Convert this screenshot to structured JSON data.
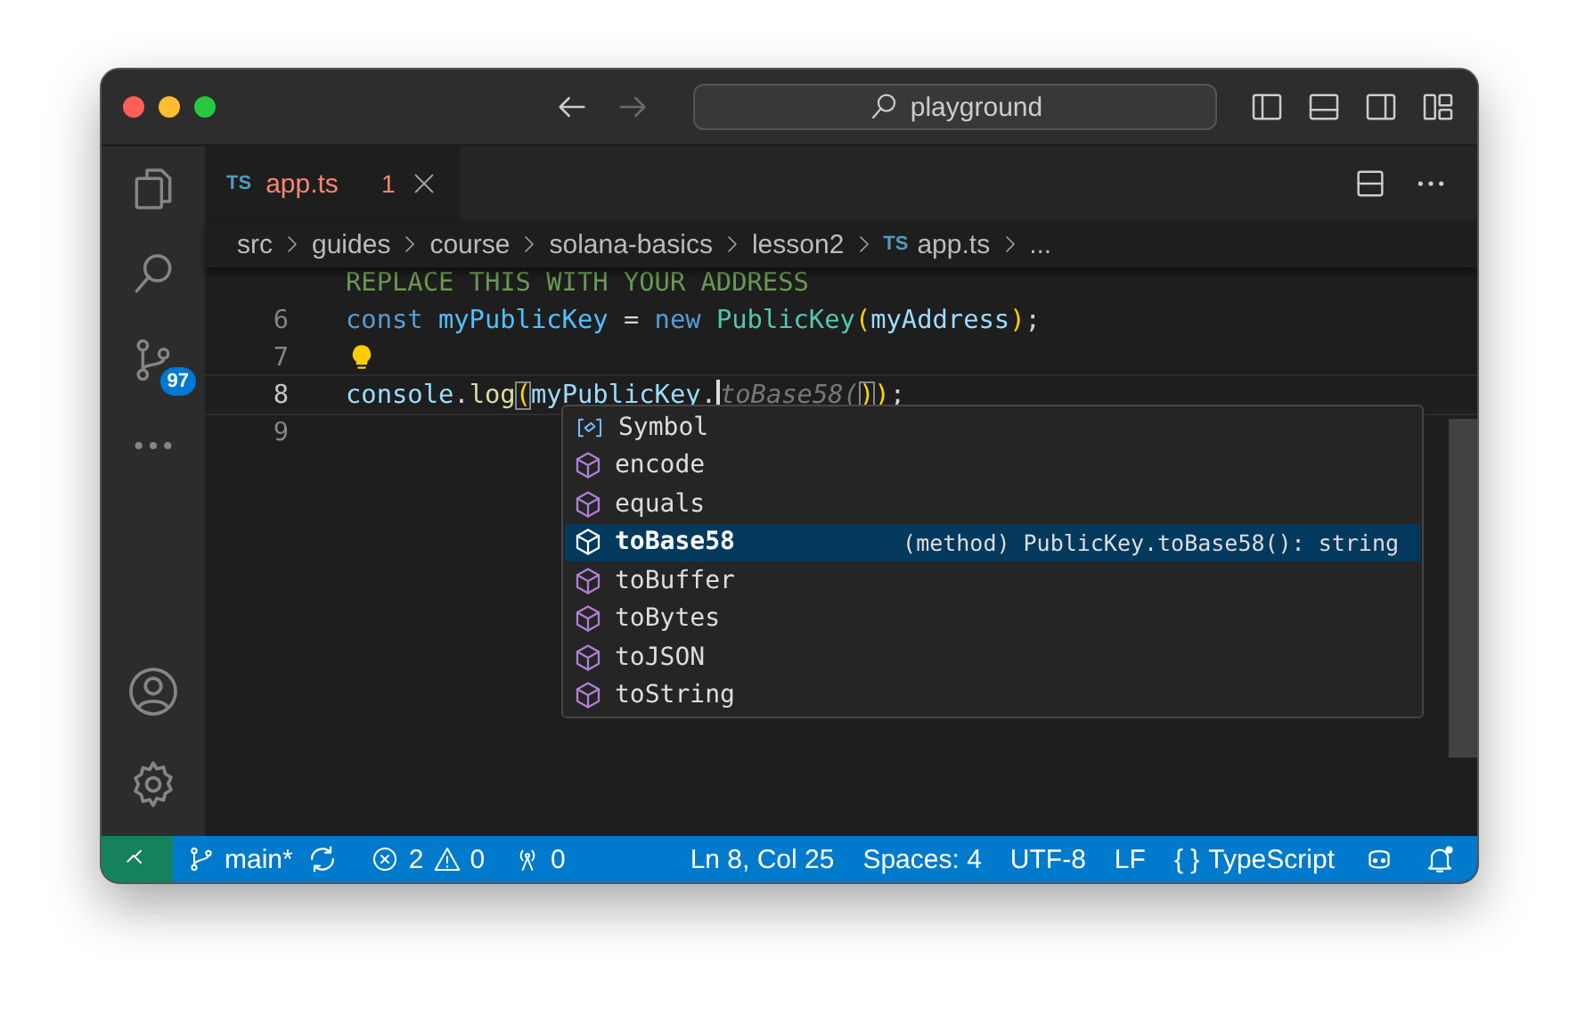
{
  "window": {
    "search": "playground",
    "nav": [
      {
        "kind": "back",
        "disabled": false
      },
      {
        "kind": "forward",
        "disabled": true
      }
    ]
  },
  "activity_bar": {
    "items": [
      {
        "kind": "explorer",
        "selected": false
      },
      {
        "kind": "search",
        "selected": false
      },
      {
        "kind": "source-control",
        "selected": false,
        "badge": "97"
      },
      {
        "kind": "more",
        "selected": false
      }
    ],
    "bottom": [
      {
        "kind": "account"
      },
      {
        "kind": "settings"
      }
    ]
  },
  "tabs": [
    {
      "icon": "TS",
      "label": "app.ts",
      "problems": "1",
      "selected": true
    }
  ],
  "breadcrumb": [
    {
      "label": "src"
    },
    {
      "label": "guides"
    },
    {
      "label": "course"
    },
    {
      "label": "solana-basics"
    },
    {
      "label": "lesson2"
    },
    {
      "label": "app.ts",
      "icon": "TS"
    },
    {
      "label": "..."
    }
  ],
  "editor": {
    "lines": [
      {
        "kind": "comment",
        "current": false,
        "tokens": [
          {
            "text": "REPLACE THIS WITH YOUR ADDRESS",
            "kind": "comment"
          }
        ]
      },
      {
        "number": "6",
        "kind": "code",
        "current": false,
        "tokens": [
          {
            "text": "const ",
            "kind": "keyword"
          },
          {
            "text": "myPublicKey",
            "kind": "constant"
          },
          {
            "text": " = ",
            "kind": "plain"
          },
          {
            "text": "new ",
            "kind": "keyword"
          },
          {
            "text": "PublicKey",
            "kind": "class"
          },
          {
            "text": "(",
            "kind": "bracket"
          },
          {
            "text": "myAddress",
            "kind": "variable"
          },
          {
            "text": ")",
            "kind": "bracket"
          },
          {
            "text": ";",
            "kind": "plain"
          }
        ]
      },
      {
        "number": "7",
        "kind": "lightbulb",
        "current": false
      },
      {
        "number": "8",
        "kind": "code",
        "current": true,
        "tokens": [
          {
            "text": "console",
            "kind": "variable"
          },
          {
            "text": ".",
            "kind": "plain"
          },
          {
            "text": "log",
            "kind": "function"
          },
          {
            "text": "(",
            "kind": "bracket-match"
          },
          {
            "text": "myPublicKey",
            "kind": "variable"
          },
          {
            "text": ".",
            "kind": "plain"
          },
          {
            "text": "toBase58(",
            "kind": "ghost"
          },
          {
            "text": ")",
            "kind": "bracket-match"
          },
          {
            "text": ")",
            "kind": "bracket"
          },
          {
            "text": ";",
            "kind": "plain"
          }
        ]
      },
      {
        "number": "9",
        "kind": "code",
        "current": false
      }
    ]
  },
  "suggestions": [
    {
      "label": "Symbol",
      "kind": "enum",
      "selected": false
    },
    {
      "label": "encode",
      "kind": "method",
      "selected": false
    },
    {
      "label": "equals",
      "kind": "method",
      "selected": false
    },
    {
      "label": "toBase58",
      "kind": "method",
      "selected": true,
      "detail": "(method) PublicKey.toBase58(): string"
    },
    {
      "label": "toBuffer",
      "kind": "method",
      "selected": false
    },
    {
      "label": "toBytes",
      "kind": "method",
      "selected": false
    },
    {
      "label": "toJSON",
      "kind": "method",
      "selected": false
    },
    {
      "label": "toString",
      "kind": "method",
      "selected": false
    }
  ],
  "status_bar": {
    "branch": "main*",
    "errors": "2",
    "warnings": "0",
    "ports": "0",
    "position": "Ln 8, Col 25",
    "indent": "Spaces: 4",
    "encoding": "UTF-8",
    "eol": "LF",
    "language_icon": "{ }",
    "language": "TypeScript"
  }
}
